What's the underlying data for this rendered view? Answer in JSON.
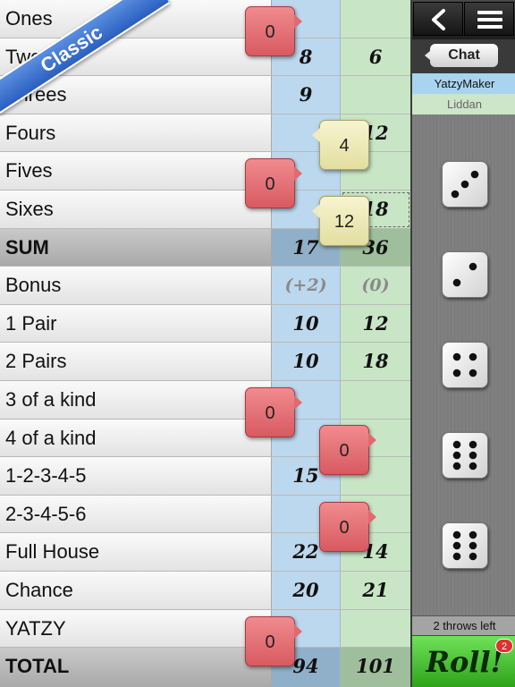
{
  "ribbon": {
    "label": "Classic"
  },
  "players": {
    "p1": "YatzyMaker",
    "p2": "Liddan"
  },
  "rows": [
    {
      "label": "Ones",
      "p1": "",
      "p2": ""
    },
    {
      "label": "Twos",
      "p1": "8",
      "p2": "6"
    },
    {
      "label": "Threes",
      "p1": "9",
      "p2": ""
    },
    {
      "label": "Fours",
      "p1": "",
      "p2": "12"
    },
    {
      "label": "Fives",
      "p1": "",
      "p2": ""
    },
    {
      "label": "Sixes",
      "p1": "",
      "p2": "18"
    },
    {
      "label": "SUM",
      "p1": "17",
      "p2": "36"
    },
    {
      "label": "Bonus",
      "p1": "(+2)",
      "p2": "(0)"
    },
    {
      "label": "1 Pair",
      "p1": "10",
      "p2": "12"
    },
    {
      "label": "2 Pairs",
      "p1": "10",
      "p2": "18"
    },
    {
      "label": "3 of a kind",
      "p1": "",
      "p2": ""
    },
    {
      "label": "4 of a kind",
      "p1": "",
      "p2": ""
    },
    {
      "label": "1-2-3-4-5",
      "p1": "15",
      "p2": ""
    },
    {
      "label": "2-3-4-5-6",
      "p1": "",
      "p2": ""
    },
    {
      "label": "Full House",
      "p1": "22",
      "p2": "14"
    },
    {
      "label": "Chance",
      "p1": "20",
      "p2": "21"
    },
    {
      "label": "YATZY",
      "p1": "",
      "p2": ""
    },
    {
      "label": "TOTAL",
      "p1": "94",
      "p2": "101"
    }
  ],
  "suggestions": [
    {
      "row": "Ones",
      "value": "0",
      "color": "red"
    },
    {
      "row": "Fours",
      "value": "4",
      "color": "yellow"
    },
    {
      "row": "Fives",
      "value": "0",
      "color": "red"
    },
    {
      "row": "Sixes",
      "value": "12",
      "color": "yellow"
    },
    {
      "row": "3 of a kind",
      "value": "0",
      "color": "red"
    },
    {
      "row": "4 of a kind",
      "value": "0",
      "color": "red"
    },
    {
      "row": "2-3-4-5-6",
      "value": "0",
      "color": "red"
    },
    {
      "row": "YATZY",
      "value": "0",
      "color": "red"
    }
  ],
  "toolbar": {
    "back_icon": "chevron-left-icon",
    "menu_icon": "list-icon",
    "chat_label": "Chat"
  },
  "dice": [
    3,
    2,
    4,
    6,
    6
  ],
  "throws_left": "2 throws left",
  "roll": {
    "label": "Roll!",
    "badge": "2"
  },
  "colors": {
    "player1": "#bcd8ee",
    "player2": "#c8e6c5",
    "suggest_red": "#e2696f",
    "suggest_yellow": "#f1ecc0",
    "roll_green": "#4cc236"
  }
}
